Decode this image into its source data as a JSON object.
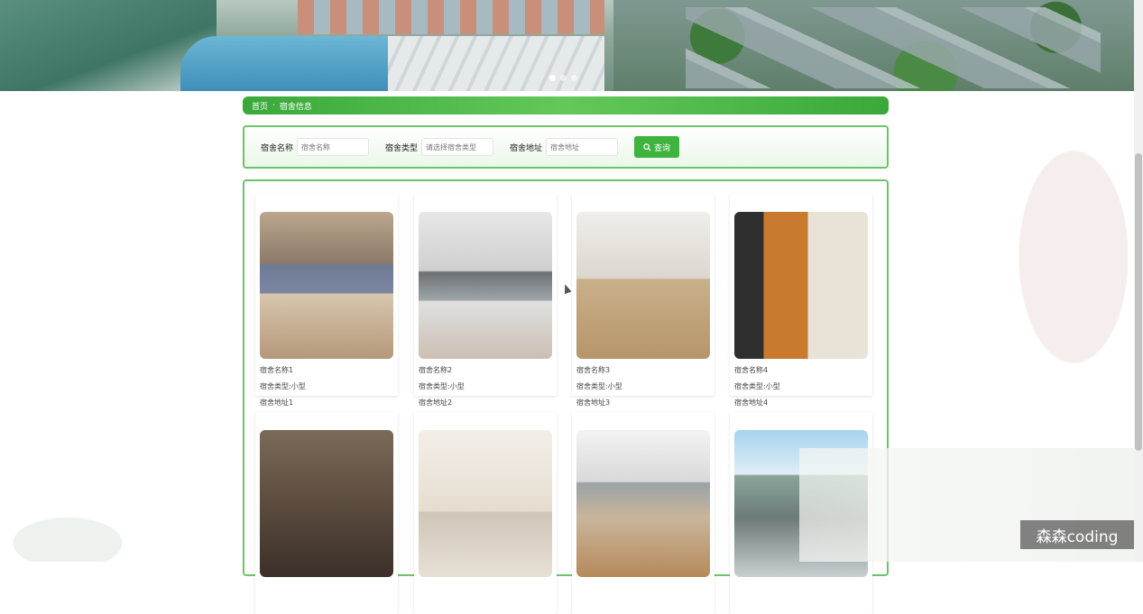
{
  "banner": {
    "slides": 3,
    "active_slide": 1
  },
  "breadcrumb": {
    "home": "首页",
    "separator": "·",
    "current": "宿舍信息"
  },
  "search": {
    "name_label": "宿舍名称",
    "name_placeholder": "宿舍名称",
    "type_label": "宿舍类型",
    "type_placeholder": "请选择宿舍类型",
    "address_label": "宿舍地址",
    "address_placeholder": "宿舍地址",
    "button_label": "查询"
  },
  "cards": [
    {
      "name": "宿舍名称1",
      "type": "宿舍类型:小型",
      "address": "宿舍地址1"
    },
    {
      "name": "宿舍名称2",
      "type": "宿舍类型:小型",
      "address": "宿舍地址2"
    },
    {
      "name": "宿舍名称3",
      "type": "宿舍类型:小型",
      "address": "宿舍地址3"
    },
    {
      "name": "宿舍名称4",
      "type": "宿舍类型:小型",
      "address": "宿舍地址4"
    },
    {
      "name": "",
      "type": "",
      "address": ""
    },
    {
      "name": "",
      "type": "",
      "address": ""
    },
    {
      "name": "",
      "type": "",
      "address": ""
    },
    {
      "name": "",
      "type": "",
      "address": ""
    }
  ],
  "watermark": "森森coding",
  "colors": {
    "accent": "#3fb33f",
    "border": "#6cc46a"
  }
}
